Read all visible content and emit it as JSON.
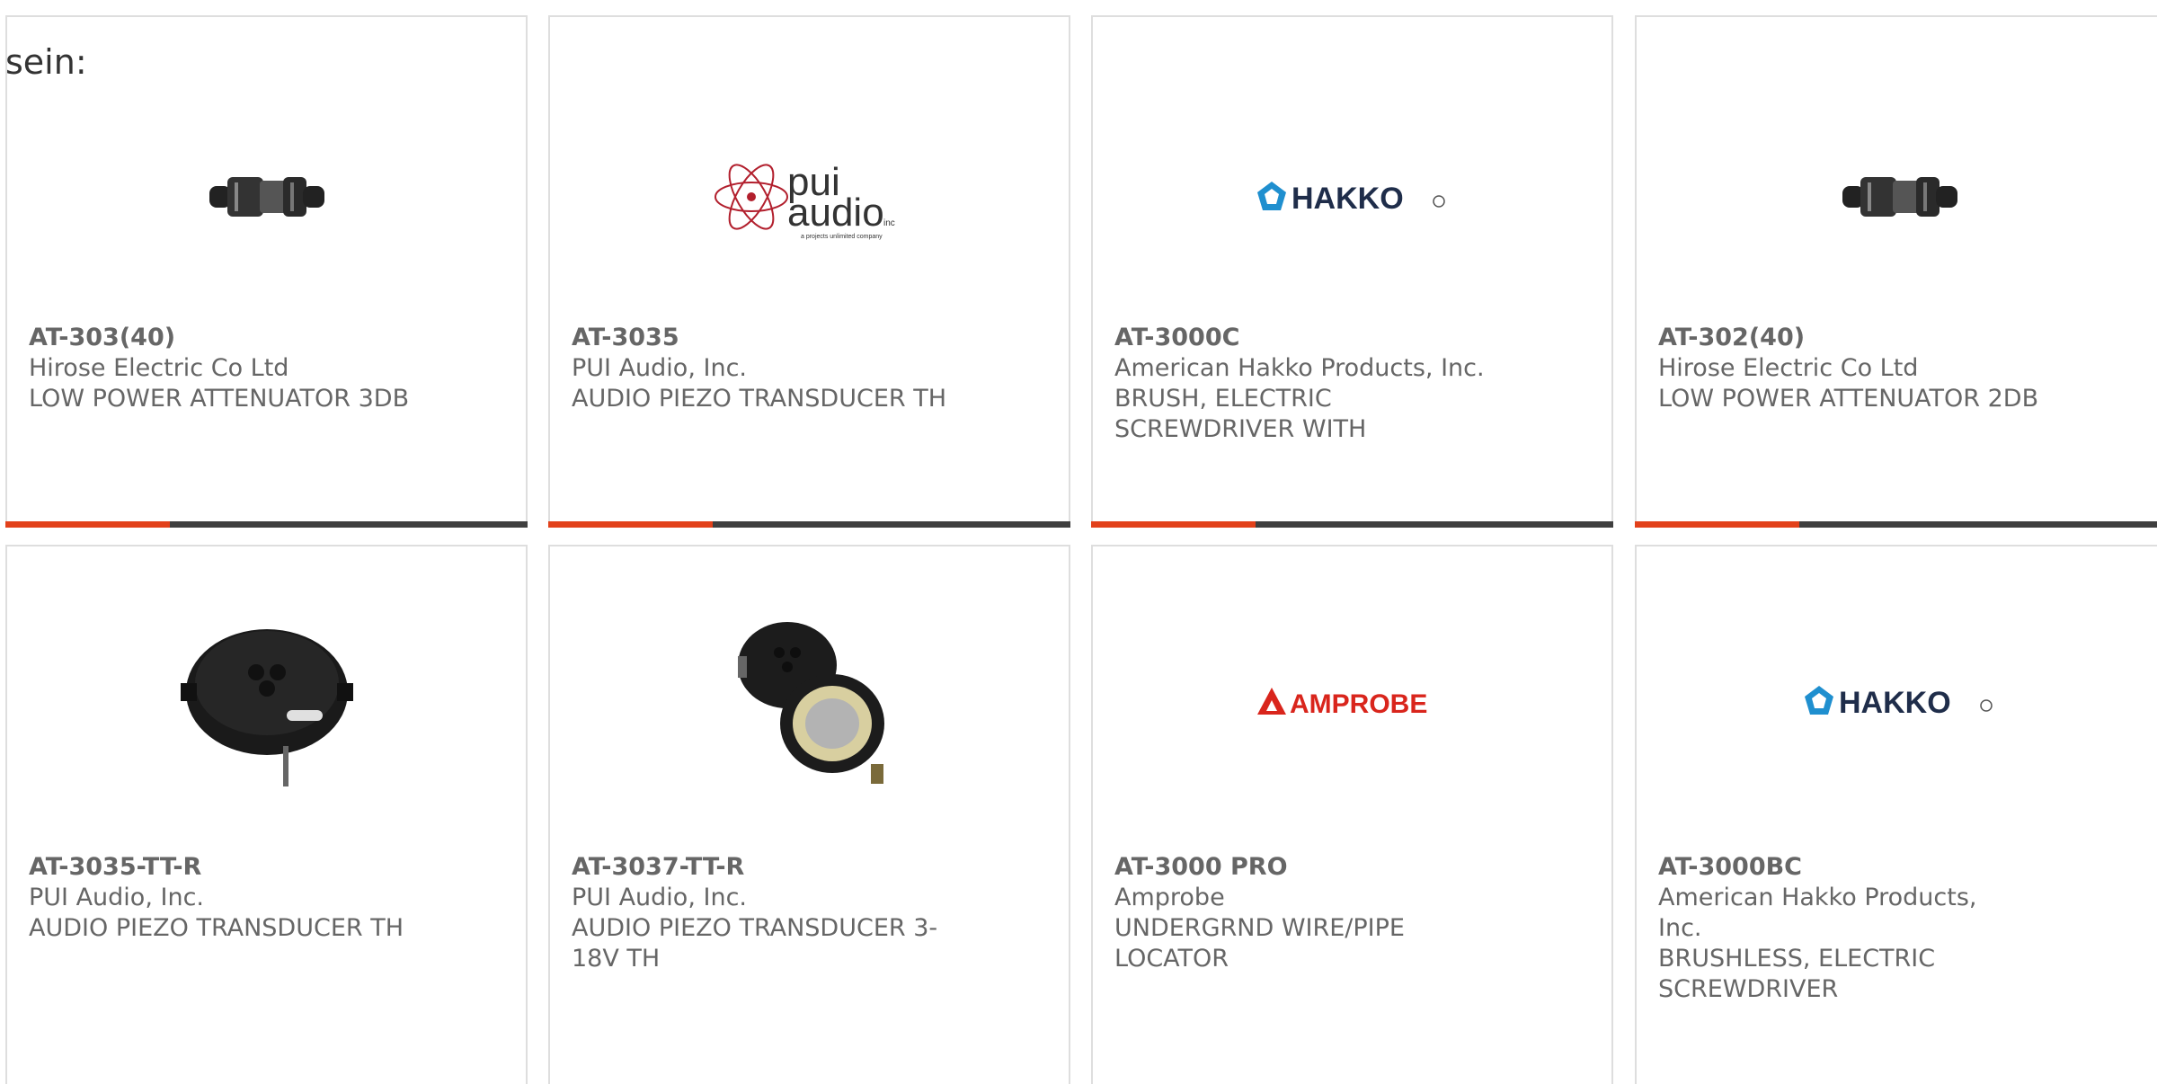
{
  "intro": "sein:",
  "products": [
    {
      "pn": "AT-303(40)",
      "mfr": "Hirose Electric Co Ltd",
      "desc": "LOW POWER ATTENUATOR 3DB",
      "image": "attenuator-connector-icon"
    },
    {
      "pn": "AT-3035",
      "mfr": "PUI Audio, Inc.",
      "desc": "AUDIO PIEZO TRANSDUCER TH",
      "image": "pui-audio-logo",
      "logo_main": "pui",
      "logo_sub": "audio",
      "logo_inc": "inc",
      "logo_tag": "a projects unlimited company"
    },
    {
      "pn": "AT-3000C",
      "mfr": "American Hakko Products, Inc.",
      "desc": "BRUSH, ELECTRIC SCREWDRIVER WITH",
      "image": "hakko-logo",
      "logo": "HAKKO"
    },
    {
      "pn": "AT-302(40)",
      "mfr": "Hirose Electric Co Ltd",
      "desc": "LOW POWER ATTENUATOR 2DB",
      "image": "attenuator-connector-icon"
    },
    {
      "pn": "AT-3035-TT-R",
      "mfr": "PUI Audio, Inc.",
      "desc": "AUDIO PIEZO TRANSDUCER TH",
      "image": "piezo-transducer-icon"
    },
    {
      "pn": "AT-3037-TT-R",
      "mfr": "PUI Audio, Inc.",
      "desc": "AUDIO PIEZO TRANSDUCER 3-18V TH",
      "image": "piezo-transducer-pair-icon"
    },
    {
      "pn": "AT-3000 PRO",
      "mfr": "Amprobe",
      "desc": "UNDERGRND WIRE/PIPE LOCATOR",
      "image": "amprobe-logo",
      "logo": "AMPROBE"
    },
    {
      "pn": "AT-3000BC",
      "mfr": "American Hakko Products, Inc.",
      "desc": "BRUSHLESS, ELECTRIC SCREWDRIVER",
      "image": "hakko-logo",
      "logo": "HAKKO"
    }
  ],
  "colors": {
    "accent": "#e2411b",
    "bar": "#3f3f3f",
    "hakko_blue": "#1f8fcf",
    "amprobe_red": "#d9251c",
    "pui_red": "#b21f2d"
  }
}
